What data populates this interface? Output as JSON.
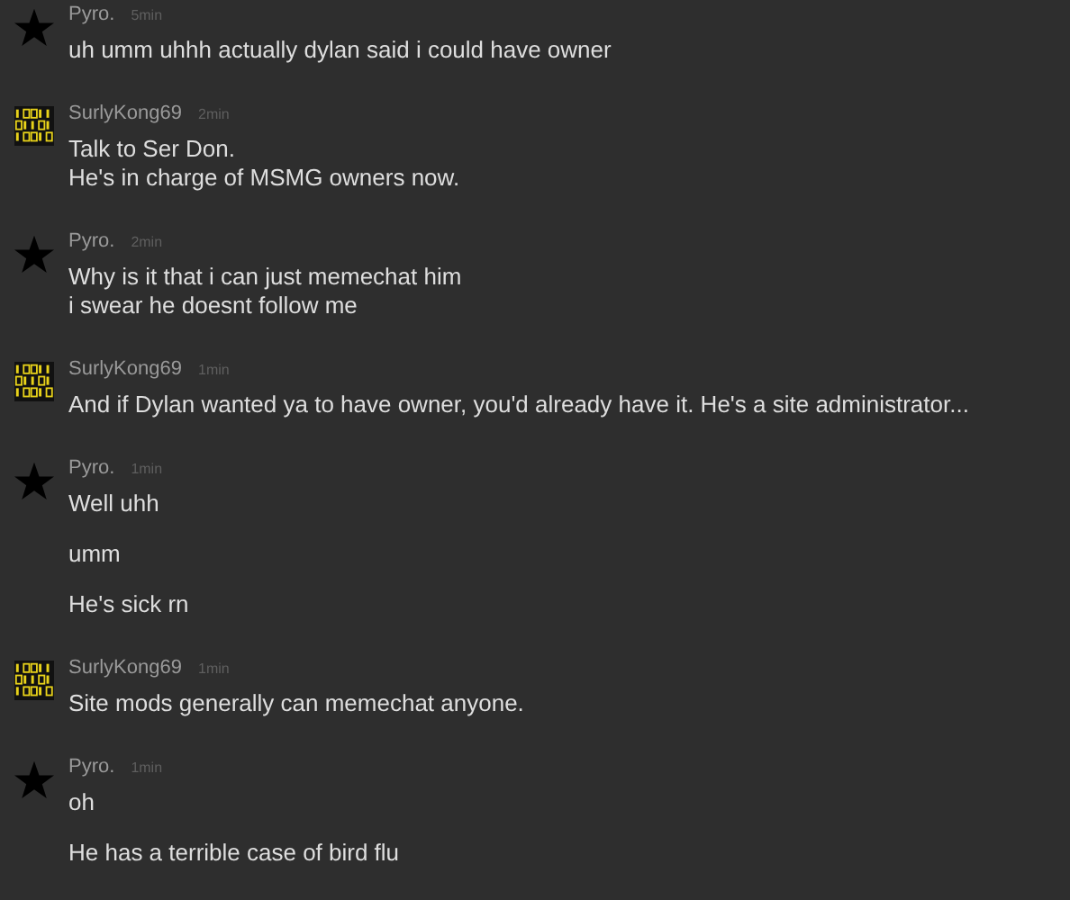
{
  "messages": [
    {
      "author": "Pyro.",
      "time": "5min",
      "kind": "star",
      "paragraphs": [
        "uh umm uhhh actually dylan said i could have owner"
      ]
    },
    {
      "author": "SurlyKong69",
      "time": "2min",
      "kind": "binary",
      "paragraphs": [
        "Talk to Ser Don.\nHe's in charge of MSMG owners now."
      ]
    },
    {
      "author": "Pyro.",
      "time": "2min",
      "kind": "star",
      "paragraphs": [
        "Why is it that i can just memechat him\ni swear he doesnt follow me"
      ]
    },
    {
      "author": "SurlyKong69",
      "time": "1min",
      "kind": "binary",
      "paragraphs": [
        "And if Dylan wanted ya to have owner, you'd already have it. He's a site administrator..."
      ]
    },
    {
      "author": "Pyro.",
      "time": "1min",
      "kind": "star",
      "paragraphs": [
        "Well uhh",
        "umm",
        "He's sick rn"
      ]
    },
    {
      "author": "SurlyKong69",
      "time": "1min",
      "kind": "binary",
      "paragraphs": [
        "Site mods generally can memechat anyone."
      ]
    },
    {
      "author": "Pyro.",
      "time": "1min",
      "kind": "star",
      "paragraphs": [
        "oh",
        "He has a terrible case of bird flu"
      ]
    }
  ]
}
